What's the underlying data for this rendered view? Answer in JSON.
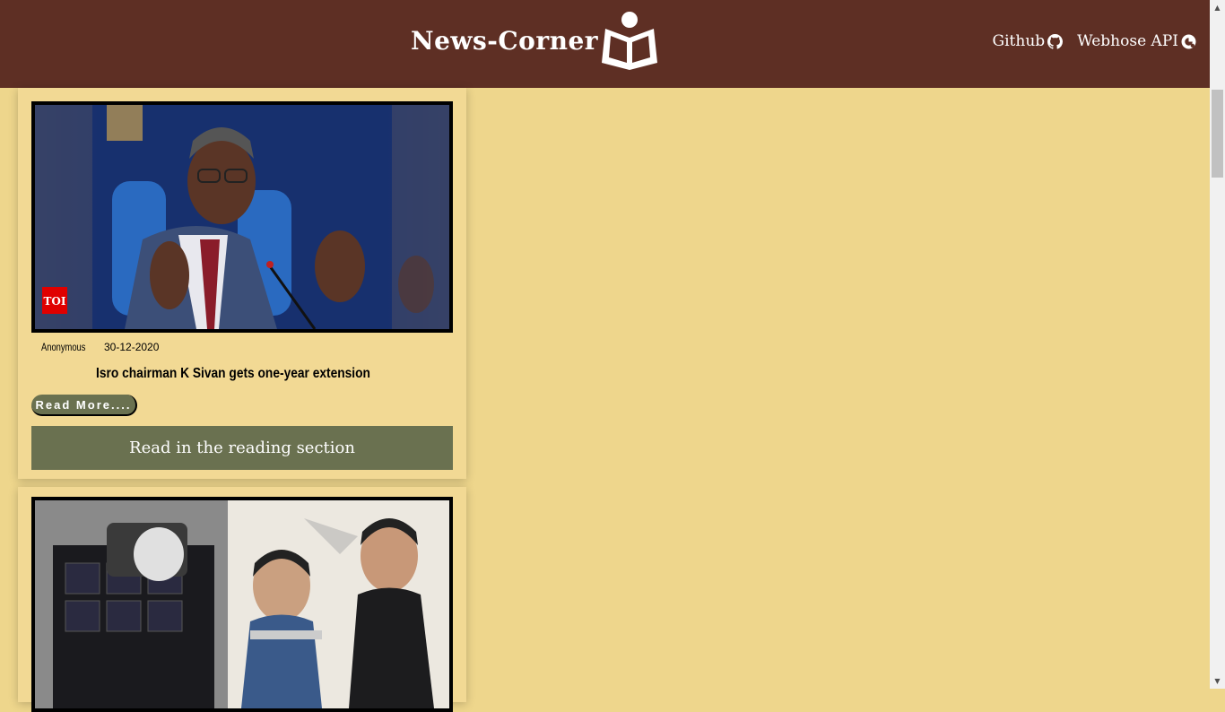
{
  "header": {
    "brand_title": "News-Corner",
    "nav": [
      {
        "label": "Github",
        "icon": "github-icon"
      },
      {
        "label": "Webhose API",
        "icon": "webhose-icon"
      }
    ],
    "background_color": "#5e2f24"
  },
  "articles": [
    {
      "author": "Anonymous",
      "date": "30-12-2020",
      "title": "Isro chairman K Sivan gets one-year extension",
      "read_more_label": "Read More....",
      "reading_section_label": "Read in the reading section",
      "image_badge": "TOI"
    },
    {
      "author": "",
      "date": "",
      "title": "",
      "read_more_label": "",
      "reading_section_label": ""
    }
  ],
  "colors": {
    "page_background": "#eed68c",
    "card_background": "#f2d994",
    "button_color": "#6a7150"
  }
}
